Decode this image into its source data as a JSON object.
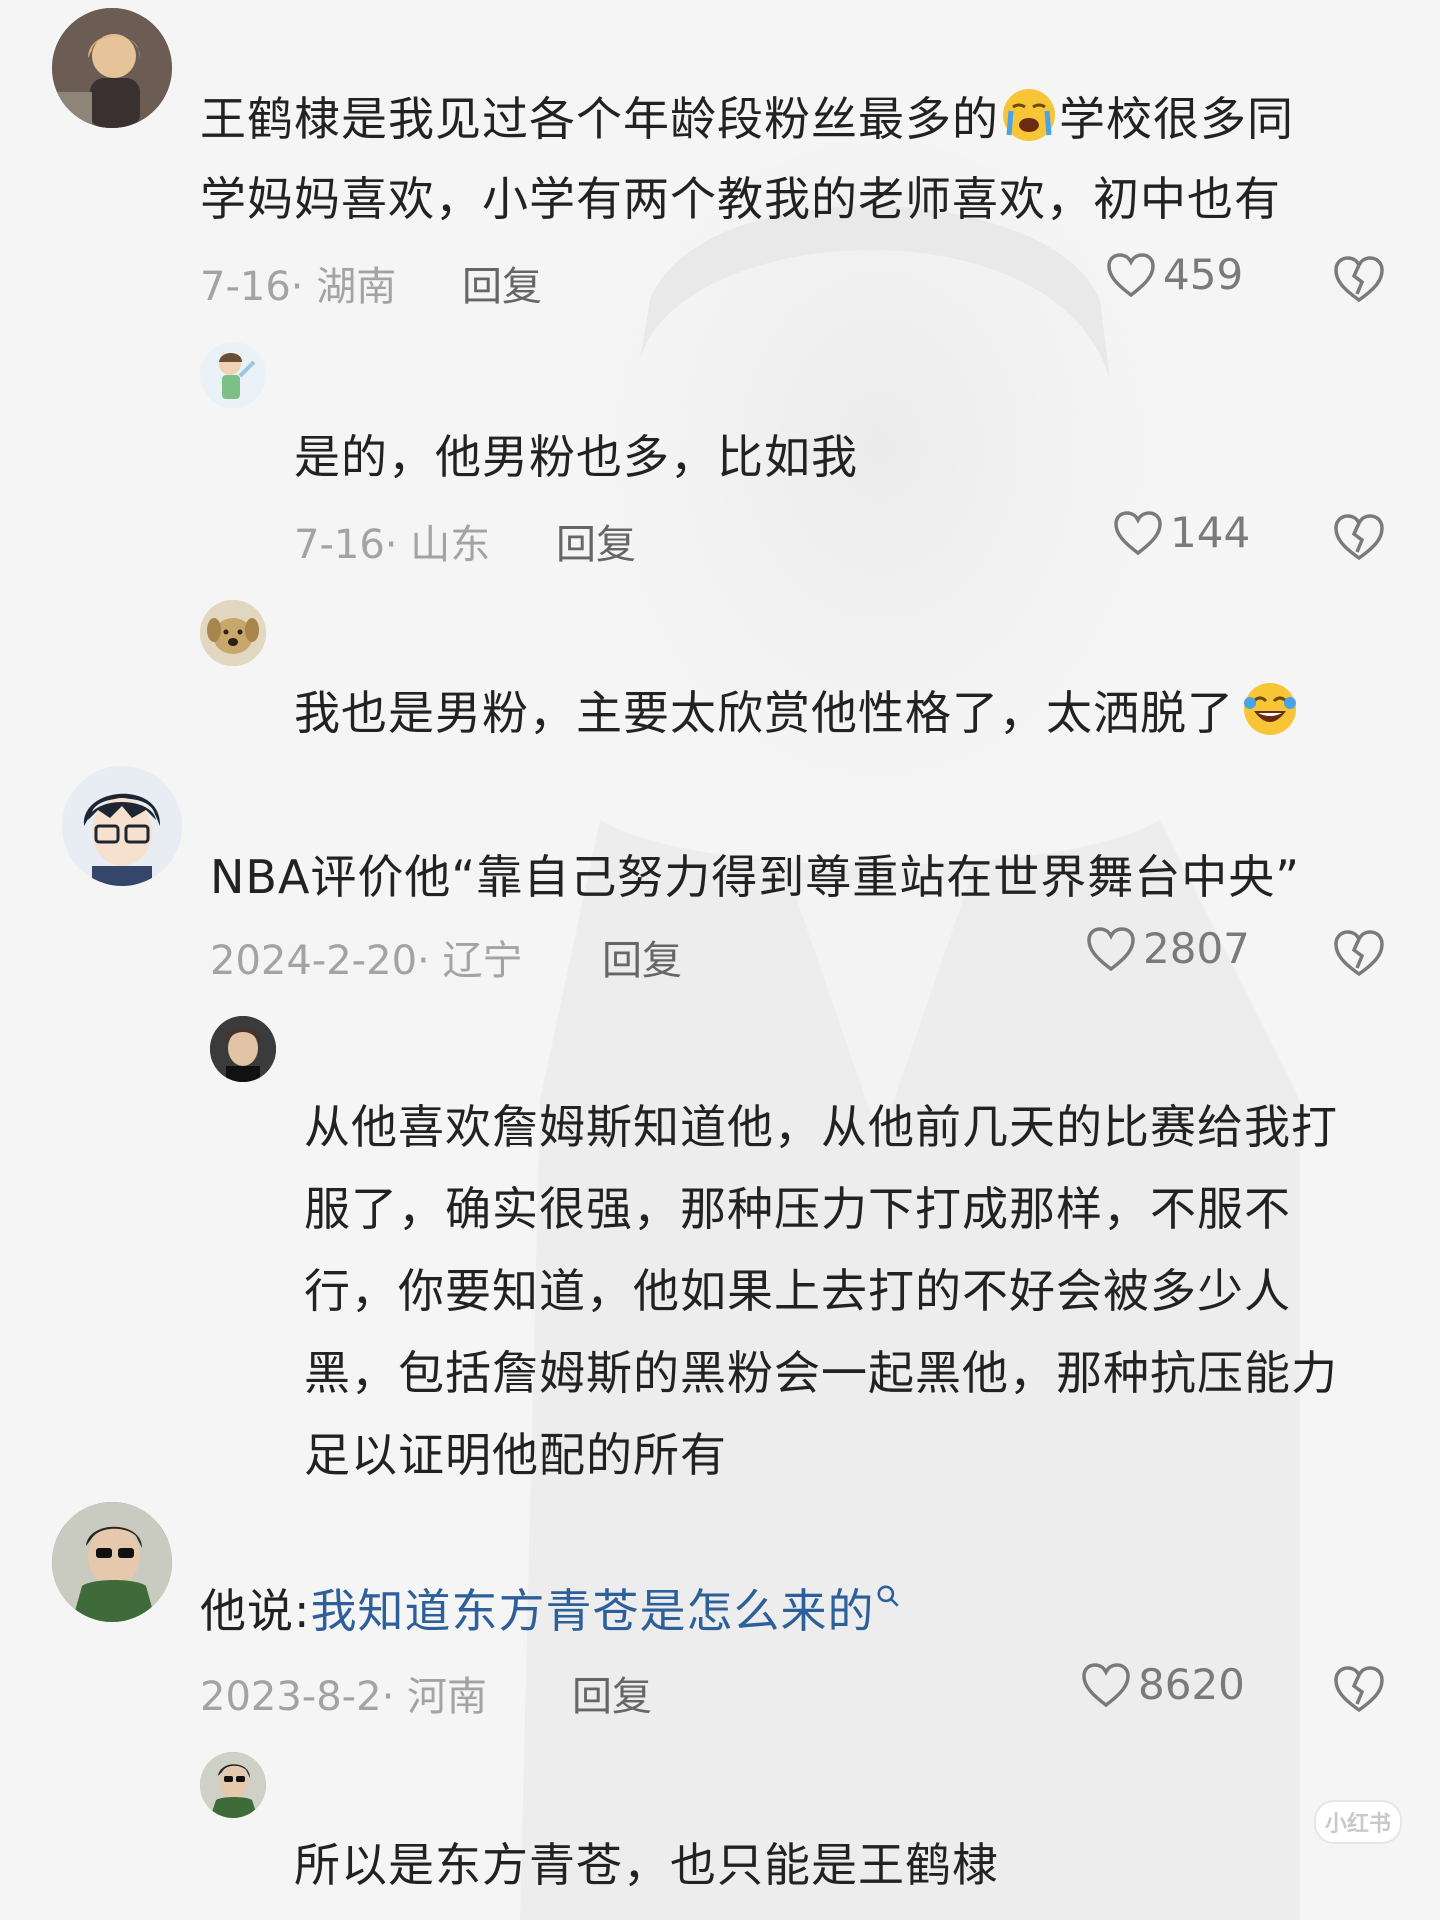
{
  "comments": [
    {
      "text": "王鹤棣是我见过各个年龄段粉丝最多的",
      "text_after_emoji": "学校很多同",
      "text_line2": "学妈妈喜欢，小学有两个教我的老师喜欢，初中也有",
      "meta": "7-16· 湖南",
      "reply": "回复",
      "likes": "459"
    },
    {
      "text": "是的，他男粉也多，比如我",
      "meta": "7-16· 山东",
      "reply": "回复",
      "likes": "144"
    },
    {
      "text": "我也是男粉，主要太欣赏他性格了，太洒脱了"
    },
    {
      "text": "NBA评价他“靠自己努力得到尊重站在世界舞台中央”",
      "meta": "2024-2-20· 辽宁",
      "reply": "回复",
      "likes": "2807"
    },
    {
      "line1": "从他喜欢詹姆斯知道他，从他前几天的比赛给我打",
      "line2": "服了，确实很强，那种压力下打成那样，不服不",
      "line3": "行，你要知道，他如果上去打的不好会被多少人",
      "line4": "黑，包括詹姆斯的黑粉会一起黑他，那种抗压能力",
      "line5": "足以证明他配的所有"
    },
    {
      "prefix": "他说:",
      "link": "我知道东方青苍是怎么来的",
      "meta": "2023-8-2· 河南",
      "reply": "回复",
      "likes": "8620"
    },
    {
      "text": "所以是东方青苍，也只能是王鹤棣"
    }
  ],
  "watermark": "小红书",
  "colors": {
    "text": "#222222",
    "meta": "#a3a3a3",
    "link": "#2d5f9a",
    "background": "#f5f5f5"
  },
  "icons": {
    "like": "heart-outline-icon",
    "dislike": "broken-heart-icon",
    "search": "search-icon"
  }
}
